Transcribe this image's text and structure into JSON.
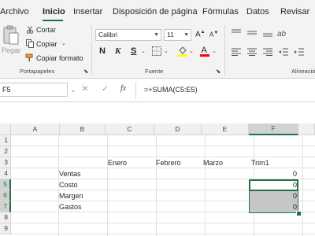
{
  "menu": {
    "tabs": [
      "Archivo",
      "Inicio",
      "Insertar",
      "Disposición de página",
      "Fórmulas",
      "Datos",
      "Revisar"
    ],
    "active": "Inicio"
  },
  "ribbon": {
    "clipboard": {
      "paste_label": "Pegar",
      "cut_label": "Cortar",
      "copy_label": "Copiar",
      "format_painter_label": "Copiar formato",
      "group_label": "Portapapeles"
    },
    "font": {
      "font_name": "Calibri",
      "font_size": "11",
      "bold": "N",
      "italic": "K",
      "underline": "S",
      "group_label": "Fuente",
      "font_color": "#ff0000",
      "fill_color": "#ffff00"
    },
    "alignment": {
      "group_label": "Alineació"
    }
  },
  "formula_bar": {
    "name_box": "F5",
    "cancel_icon": "✕",
    "enter_icon": "✓",
    "fx_label": "fx",
    "formula": "=+SUMA(C5:E5)"
  },
  "grid": {
    "columns": [
      "A",
      "B",
      "C",
      "D",
      "E",
      "F"
    ],
    "rows": [
      "1",
      "2",
      "3",
      "4",
      "5",
      "6",
      "7",
      "8",
      "9"
    ],
    "selected_column": "F",
    "selected_rows": [
      "5",
      "6",
      "7"
    ],
    "active_cell": "F5",
    "cells": {
      "C3": "Enero",
      "D3": "Febrero",
      "E3": "Marzo",
      "F3": "Trim1",
      "B4": "Ventas",
      "F4": "0",
      "B5": "Costo",
      "F5": "0",
      "B6": "Margen",
      "F6": "0",
      "B7": "Gastos",
      "F7": "0"
    }
  },
  "colors": {
    "accent": "#217346",
    "selection": "#c6c6c6",
    "ribbon_bg": "#f3f3f3"
  }
}
